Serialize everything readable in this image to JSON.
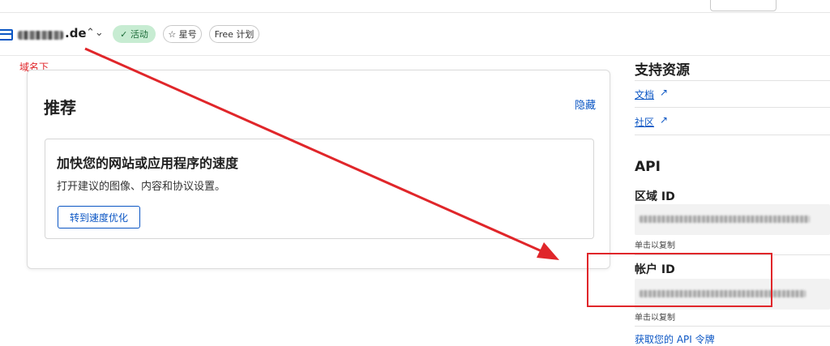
{
  "header": {
    "domain_suffix": ".de",
    "status_label": "活动",
    "star_label": "星号",
    "plan_label": "Free 计划"
  },
  "annotation": {
    "label": "域名下",
    "color": "#e0262a"
  },
  "recommend": {
    "title": "推荐",
    "hide_label": "隐藏",
    "card": {
      "title": "加快您的网站或应用程序的速度",
      "description": "打开建议的图像、内容和协议设置。",
      "button_label": "转到速度优化"
    }
  },
  "sidebar": {
    "support_title": "支持资源",
    "links": [
      {
        "label": "文档"
      },
      {
        "label": "社区"
      }
    ],
    "api_title": "API",
    "zone_id_label": "区域 ID",
    "zone_id_hint": "单击以复制",
    "account_id_label": "帐户 ID",
    "account_id_hint": "单击以复制",
    "more_link": "获取您的 API 令牌"
  },
  "colors": {
    "accent": "#0b56c4",
    "active_bg": "#c7ecd2",
    "active_text": "#1c6b38"
  },
  "icons": [
    "site-window-icon",
    "chevron-updown-icon",
    "check-icon",
    "star-icon",
    "external-link-icon"
  ]
}
